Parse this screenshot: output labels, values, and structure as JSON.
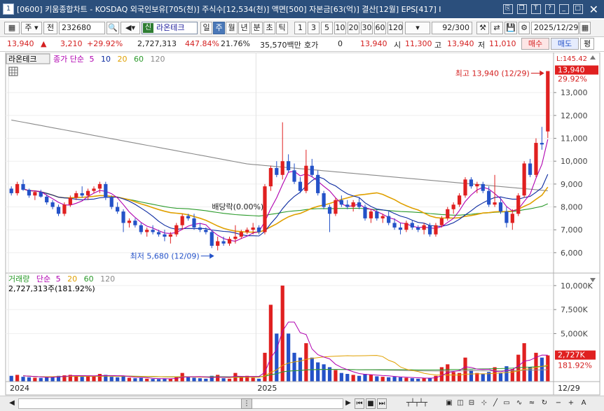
{
  "window": {
    "number": "1",
    "title": "[0600] 키움종합차트 - KOSDAQ 외국인보유[705(천)] 주식수[12,534(천)] 액면[500] 자본금[63(억)] 결산[12월] EPS[417] I"
  },
  "toolbar": {
    "period_select": "주",
    "prev_label": "전",
    "code": "232680",
    "name_badge": "신",
    "name": "라온테크",
    "periods": [
      "일",
      "주",
      "월",
      "년",
      "분",
      "초",
      "틱"
    ],
    "selected_period": "주",
    "intervals": [
      "1",
      "3",
      "5",
      "10",
      "20",
      "30",
      "60",
      "120"
    ],
    "count_value": "92",
    "count_total": "/300",
    "date": "2025/12/29"
  },
  "quote": {
    "price": "13,940",
    "change": "3,210",
    "change_pct": "+29.92%",
    "volume": "2,727,313",
    "volume_pct": "447.84%",
    "turnover": "21.76%",
    "amount": "35,570백만",
    "hoga_label": "호가",
    "hoga_value": "0",
    "hoga_price": "13,940",
    "open_label": "시",
    "open": "11,300",
    "high_label": "고",
    "high": "13,940",
    "low_label": "저",
    "low": "11,010",
    "buy_label": "매수",
    "sell_label": "매도",
    "eval_label": "평"
  },
  "colors": {
    "up": "#e02020",
    "down": "#2452c8",
    "ma5": "#b000b0",
    "ma10": "#0b2aa0",
    "ma20": "#e0a000",
    "ma60": "#2a9a2a",
    "ma120": "#8a8a8a"
  },
  "chart_data": {
    "type": "candlestick",
    "price_panel": {
      "stock_tag": "라온테크",
      "legend_prefix": "종가 단순",
      "ma_periods": [
        "5",
        "10",
        "20",
        "60",
        "120"
      ],
      "ymin": 5200,
      "ymax": 14200,
      "y_ticks": [
        6000,
        7000,
        8000,
        9000,
        10000,
        11000,
        12000,
        13000
      ],
      "y_tick_labels": [
        "6,000",
        "7,000",
        "8,000",
        "9,000",
        "10,000",
        "11,000",
        "12,000",
        "13,000"
      ],
      "top_label": "L:145.42",
      "last_price_label": "13,940",
      "last_pct_label": "29.92%",
      "annotations": {
        "high": "최고 13,940 (12/29)",
        "low": "최저 5,680 (12/09)",
        "dividend": "배당락(0.00%)"
      }
    },
    "volume_panel": {
      "legend_title": "거래량",
      "legend_prefix": "단순",
      "ma_periods": [
        "5",
        "20",
        "60",
        "120"
      ],
      "current_label": "2,727,313주(181.92%)",
      "ymax": 10500000,
      "y_ticks": [
        5000000,
        7500000,
        10000000
      ],
      "y_tick_labels": [
        "5,000K",
        "7,500K",
        "10,000K"
      ],
      "last_vol_label": "2,727K",
      "last_pct_label": "181.92%"
    },
    "x_labels": [
      {
        "index": 0,
        "label": "2024"
      },
      {
        "index": 42,
        "label": "2025"
      }
    ],
    "last_date_label": "12/29",
    "candles": [
      [
        8800,
        8900,
        8500,
        8600,
        600000
      ],
      [
        8600,
        9100,
        8500,
        9000,
        700000
      ],
      [
        9000,
        9200,
        8700,
        8750,
        500000
      ],
      [
        8750,
        8800,
        8400,
        8500,
        450000
      ],
      [
        8500,
        8700,
        8300,
        8650,
        400000
      ],
      [
        8650,
        8750,
        8400,
        8450,
        380000
      ],
      [
        8450,
        8550,
        8100,
        8200,
        500000
      ],
      [
        8200,
        8300,
        7900,
        8000,
        550000
      ],
      [
        8000,
        8100,
        7600,
        7700,
        600000
      ],
      [
        7700,
        8200,
        7600,
        8100,
        650000
      ],
      [
        8100,
        8500,
        8000,
        8400,
        700000
      ],
      [
        8400,
        8700,
        8300,
        8600,
        650000
      ],
      [
        8600,
        8900,
        8400,
        8500,
        500000
      ],
      [
        8500,
        8800,
        8300,
        8700,
        550000
      ],
      [
        8700,
        8900,
        8600,
        8800,
        600000
      ],
      [
        8800,
        9100,
        8600,
        9000,
        800000
      ],
      [
        9000,
        9100,
        8300,
        8400,
        700000
      ],
      [
        8400,
        8500,
        7900,
        8000,
        500000
      ],
      [
        8000,
        8200,
        7700,
        7800,
        450000
      ],
      [
        7800,
        7900,
        6900,
        7300,
        600000
      ],
      [
        7300,
        7500,
        7100,
        7400,
        400000
      ],
      [
        7400,
        7500,
        7100,
        7200,
        350000
      ],
      [
        7200,
        7300,
        6800,
        6900,
        380000
      ],
      [
        6900,
        7100,
        6700,
        7000,
        300000
      ],
      [
        7000,
        7200,
        6800,
        6900,
        280000
      ],
      [
        6900,
        7000,
        6700,
        6800,
        260000
      ],
      [
        6800,
        7000,
        6500,
        6700,
        300000
      ],
      [
        6700,
        6900,
        6400,
        6800,
        320000
      ],
      [
        6800,
        7300,
        6700,
        7200,
        500000
      ],
      [
        7200,
        7700,
        7000,
        7600,
        900000
      ],
      [
        7600,
        7700,
        7400,
        7500,
        450000
      ],
      [
        7500,
        7700,
        7000,
        7100,
        400000
      ],
      [
        7100,
        7300,
        6900,
        7000,
        350000
      ],
      [
        7000,
        7100,
        6800,
        6900,
        300000
      ],
      [
        6900,
        7000,
        6200,
        6300,
        600000
      ],
      [
        6300,
        6700,
        6100,
        6500,
        700000
      ],
      [
        6500,
        6700,
        6300,
        6400,
        350000
      ],
      [
        6400,
        6700,
        6300,
        6600,
        300000
      ],
      [
        6600,
        7200,
        6400,
        6700,
        900000
      ],
      [
        6700,
        7000,
        6600,
        6900,
        500000
      ],
      [
        6900,
        7100,
        6800,
        7000,
        600000
      ],
      [
        7000,
        7300,
        6800,
        7100,
        400000
      ],
      [
        7100,
        7200,
        6800,
        6900,
        300000
      ],
      [
        6900,
        9000,
        6800,
        8900,
        3000000
      ],
      [
        8900,
        9800,
        8700,
        9700,
        8000000
      ],
      [
        9700,
        10000,
        9300,
        9400,
        5000000
      ],
      [
        9400,
        11700,
        9200,
        10000,
        10000000
      ],
      [
        10000,
        10300,
        9500,
        9600,
        5000000
      ],
      [
        9600,
        9900,
        9000,
        9100,
        3000000
      ],
      [
        9100,
        9300,
        8600,
        8700,
        2500000
      ],
      [
        8700,
        10500,
        8600,
        9800,
        4000000
      ],
      [
        9800,
        10100,
        9300,
        9400,
        2500000
      ],
      [
        9400,
        9600,
        8500,
        8600,
        2000000
      ],
      [
        8600,
        8700,
        7900,
        8000,
        1800000
      ],
      [
        8000,
        8100,
        6900,
        7700,
        1500000
      ],
      [
        7700,
        8400,
        7600,
        8300,
        1200000
      ],
      [
        8300,
        8500,
        8000,
        8100,
        900000
      ],
      [
        8100,
        8300,
        7900,
        8000,
        800000
      ],
      [
        8000,
        8300,
        7800,
        8200,
        700000
      ],
      [
        8200,
        8400,
        7900,
        8000,
        600000
      ],
      [
        8000,
        8100,
        7400,
        7500,
        800000
      ],
      [
        7500,
        7900,
        7300,
        7800,
        700000
      ],
      [
        7800,
        7900,
        7400,
        7500,
        550000
      ],
      [
        7500,
        7700,
        7300,
        7600,
        500000
      ],
      [
        7600,
        7800,
        7200,
        7300,
        450000
      ],
      [
        7300,
        7500,
        7000,
        7100,
        500000
      ],
      [
        7100,
        7300,
        6800,
        7000,
        450000
      ],
      [
        7000,
        7400,
        6900,
        7300,
        400000
      ],
      [
        7300,
        7400,
        7000,
        7100,
        350000
      ],
      [
        7100,
        7200,
        6900,
        7000,
        300000
      ],
      [
        7000,
        7300,
        6800,
        7200,
        350000
      ],
      [
        7200,
        7300,
        6700,
        6800,
        400000
      ],
      [
        6800,
        7300,
        6700,
        7200,
        600000
      ],
      [
        7200,
        7600,
        7100,
        7500,
        1500000
      ],
      [
        7500,
        8000,
        7400,
        7900,
        1800000
      ],
      [
        7900,
        8200,
        7700,
        8100,
        1000000
      ],
      [
        8100,
        8600,
        8000,
        8500,
        900000
      ],
      [
        8500,
        9300,
        8400,
        9200,
        2500000
      ],
      [
        9200,
        9300,
        8800,
        8900,
        1200000
      ],
      [
        8900,
        9100,
        8600,
        9000,
        900000
      ],
      [
        9000,
        9100,
        8600,
        8700,
        800000
      ],
      [
        8700,
        8900,
        8000,
        8100,
        1000000
      ],
      [
        8100,
        9400,
        8000,
        8200,
        1500000
      ],
      [
        8200,
        8400,
        7700,
        7800,
        900000
      ],
      [
        7800,
        8000,
        7100,
        7300,
        1600000
      ],
      [
        7300,
        7900,
        7000,
        7700,
        1300000
      ],
      [
        7700,
        8600,
        7600,
        8500,
        2800000
      ],
      [
        8500,
        10000,
        8400,
        9900,
        4000000
      ],
      [
        9900,
        10100,
        9300,
        9400,
        1500000
      ],
      [
        9400,
        11000,
        9300,
        10800,
        3000000
      ],
      [
        10800,
        11500,
        10500,
        10730,
        2500000
      ],
      [
        11300,
        13940,
        11010,
        13940,
        2727313
      ]
    ]
  },
  "scroll": {
    "left_arrow": "◀",
    "right_arrow": "▶",
    "zoom_minus": "−",
    "zoom_plus": "+",
    "zoom_A": "A"
  }
}
